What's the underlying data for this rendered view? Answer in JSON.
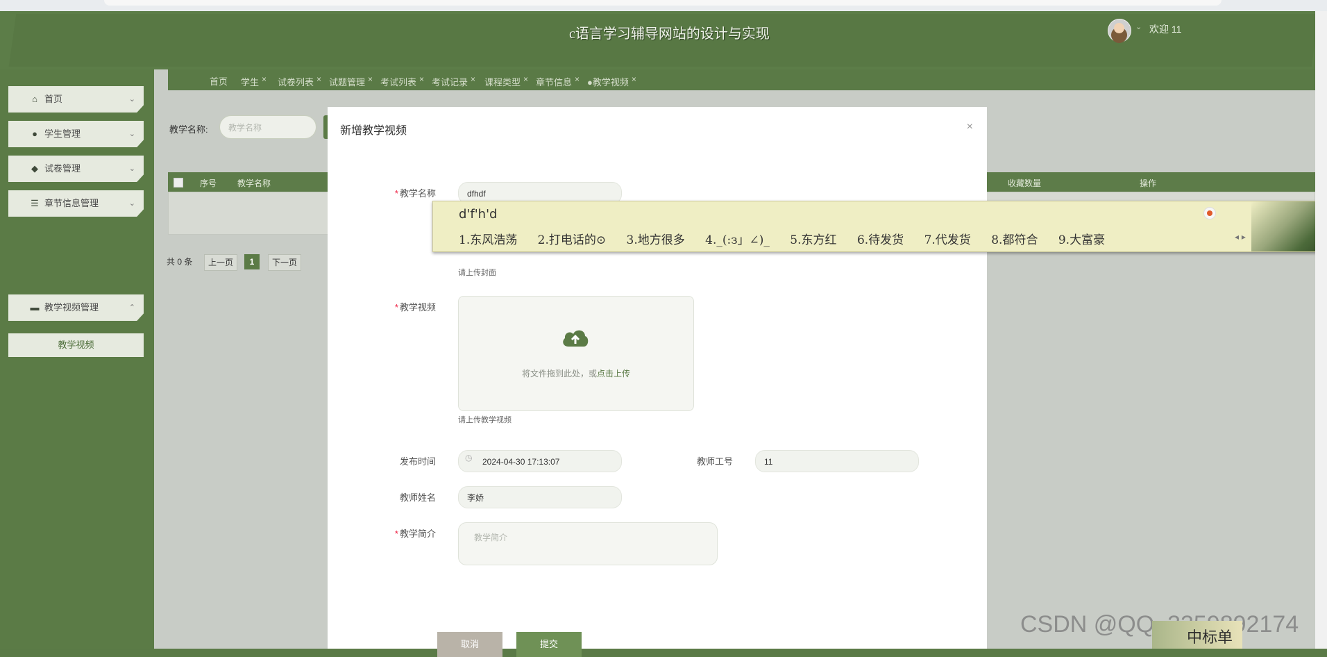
{
  "header": {
    "title": "c语言学习辅导网站的设计与实现",
    "welcome": "欢迎 11"
  },
  "sidebar": {
    "items": [
      {
        "label": "首页",
        "icon": "home-icon"
      },
      {
        "label": "学生管理",
        "icon": "user-icon"
      },
      {
        "label": "试卷管理",
        "icon": "drop-icon"
      },
      {
        "label": "章节信息管理",
        "icon": "list-icon"
      },
      {
        "label": "教学视频管理",
        "icon": "box-icon"
      }
    ],
    "sub_item": "教学视频"
  },
  "tabs": [
    {
      "label": "首页"
    },
    {
      "label": "学生"
    },
    {
      "label": "试卷列表"
    },
    {
      "label": "试题管理"
    },
    {
      "label": "考试列表"
    },
    {
      "label": "考试记录"
    },
    {
      "label": "课程类型"
    },
    {
      "label": "章节信息"
    },
    {
      "label": "●教学视频"
    }
  ],
  "search": {
    "label": "教学名称:",
    "placeholder": "教学名称"
  },
  "table": {
    "headers": [
      "序号",
      "教学名称",
      "收藏数量",
      "操作"
    ]
  },
  "pager": {
    "total": "共 0 条",
    "prev": "上一页",
    "page": "1",
    "next": "下一页"
  },
  "modal": {
    "title": "新增教学视频",
    "close": "×",
    "fields": {
      "name_label": "教学名称",
      "name_value": "dfhdf",
      "cover_hint": "请上传封面",
      "video_label": "教学视频",
      "upload_text": "将文件拖到此处，或",
      "upload_link": "点击上传",
      "video_hint": "请上传教学视频",
      "publish_label": "发布时间",
      "publish_value": "2024-04-30 17:13:07",
      "teacher_no_label": "教师工号",
      "teacher_no_value": "11",
      "teacher_name_label": "教师姓名",
      "teacher_name_value": "李娇",
      "intro_label": "教学简介",
      "intro_placeholder": "教学简介"
    },
    "cancel": "取消",
    "submit": "提交"
  },
  "ime": {
    "composition": "d'f'h'd",
    "candidates": [
      "1.东风浩荡",
      "2.打电话的⊙",
      "3.地方很多",
      "4._(:з」∠)_",
      "5.东方红",
      "6.待发货",
      "7.代发货",
      "8.都符合",
      "9.大富豪"
    ]
  },
  "watermark": "CSDN @QQ_3359892174",
  "corner_text": "中标单",
  "colors": {
    "theme_green": "#5b7b46",
    "required": "#ee2244"
  }
}
